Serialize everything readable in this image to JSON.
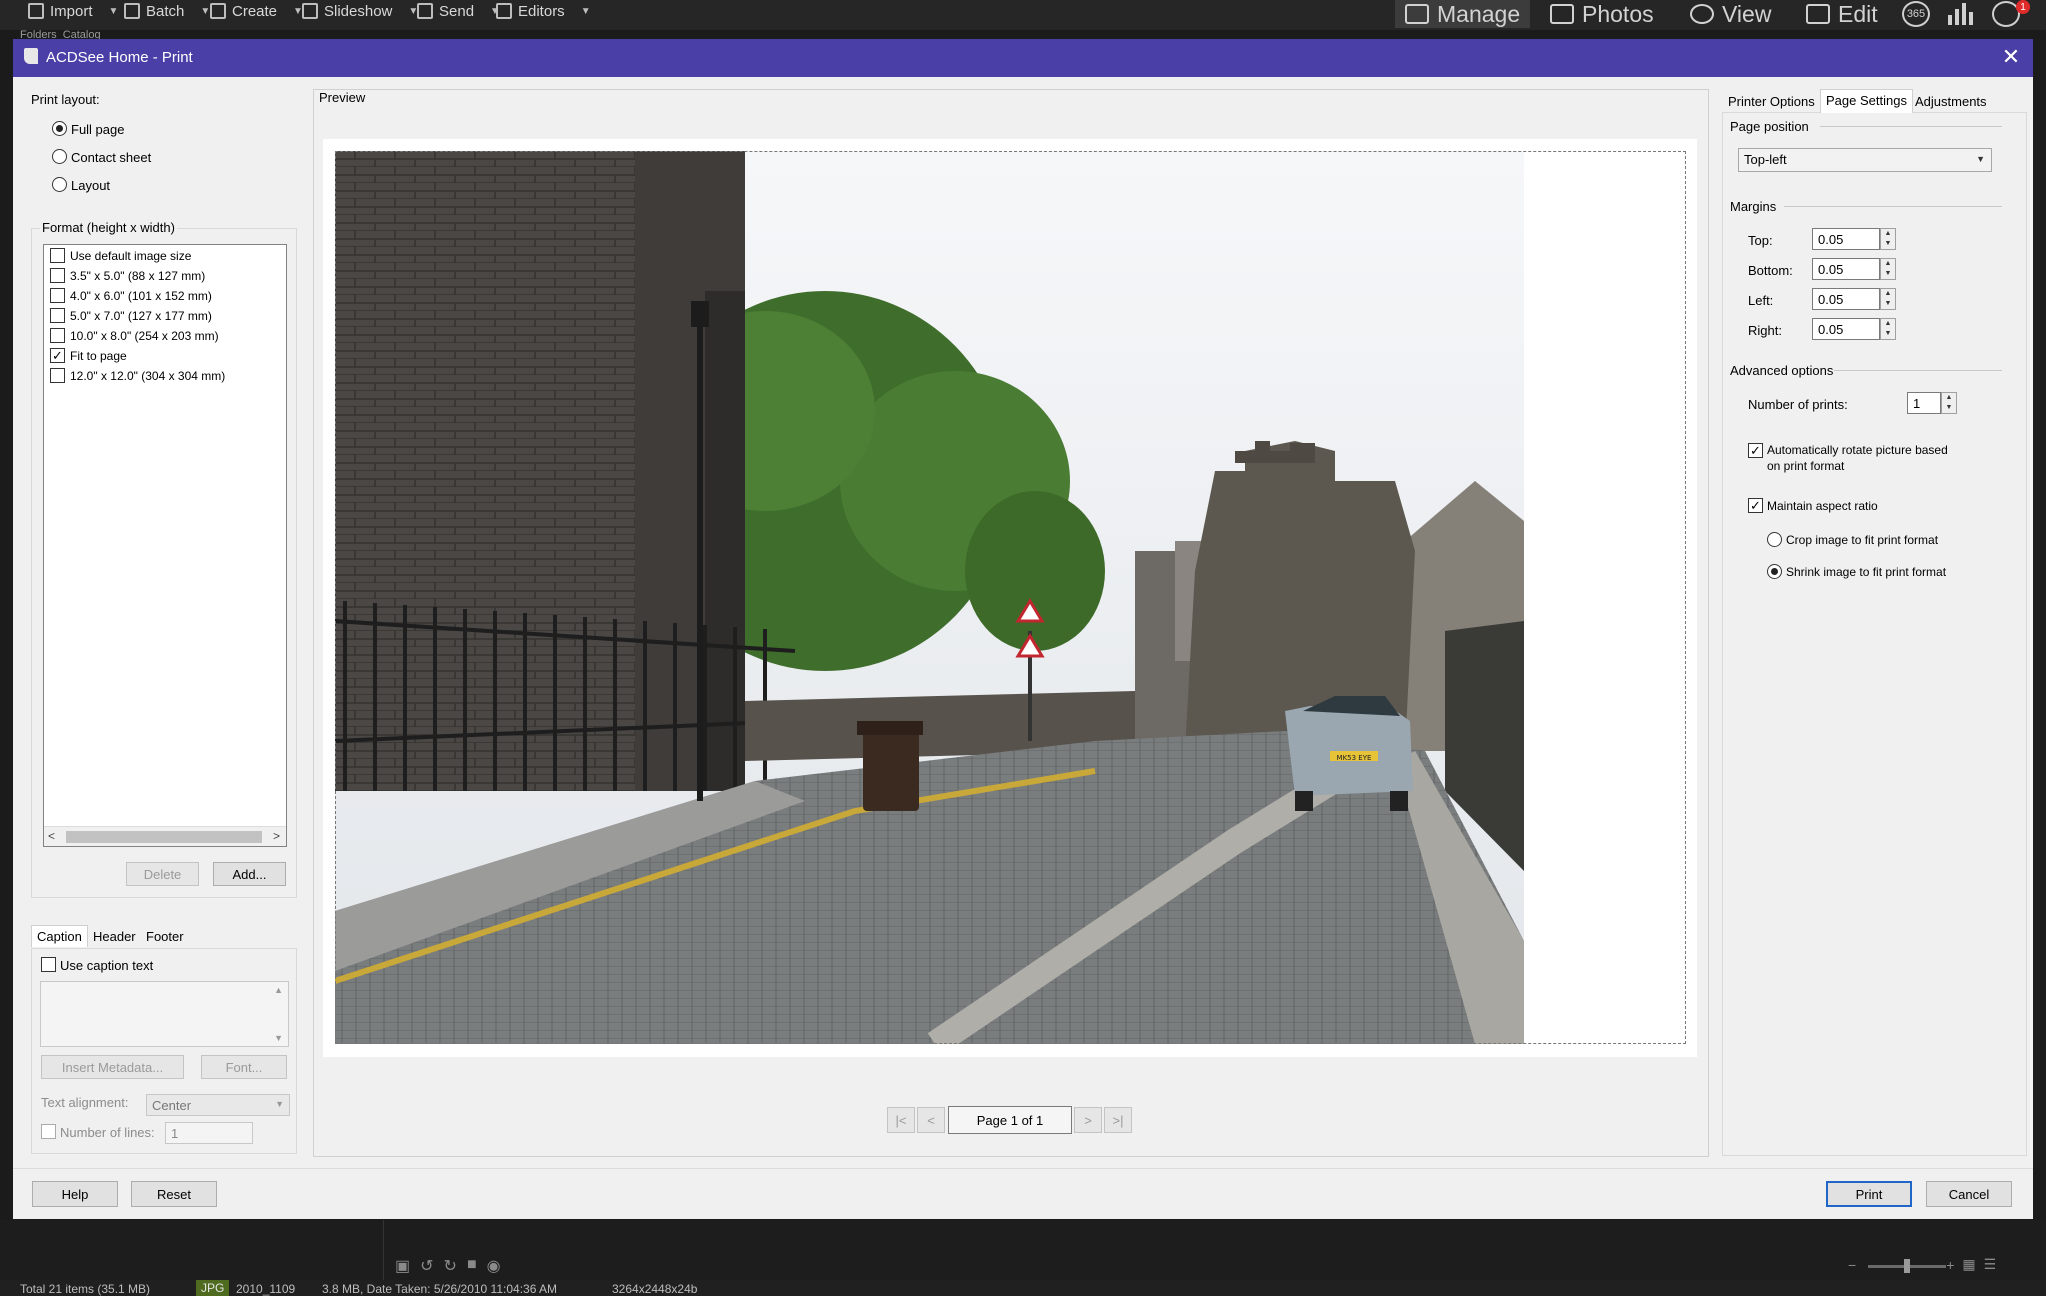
{
  "toolbar": {
    "items": [
      {
        "label": "Import",
        "icon": "import-icon"
      },
      {
        "label": "Batch",
        "icon": "batch-icon"
      },
      {
        "label": "Create",
        "icon": "create-icon"
      },
      {
        "label": "Slideshow",
        "icon": "slideshow-icon"
      },
      {
        "label": "Send",
        "icon": "send-icon"
      },
      {
        "label": "Editors",
        "icon": "editors-icon"
      }
    ],
    "modes": [
      {
        "label": "Manage",
        "icon": "grid-icon",
        "active": true
      },
      {
        "label": "Photos",
        "icon": "photos-icon",
        "active": false
      },
      {
        "label": "View",
        "icon": "eye-icon",
        "active": false
      },
      {
        "label": "Edit",
        "icon": "edit-icon",
        "active": false
      }
    ],
    "badge_365": "365",
    "notification_count": "1",
    "behind_tabs": [
      "Folders",
      "Catalog"
    ]
  },
  "dialog": {
    "title": "ACDSee Home - Print",
    "left": {
      "print_layout_label": "Print layout:",
      "layout_options": [
        "Full page",
        "Contact sheet",
        "Layout"
      ],
      "selected_layout": "Full page",
      "format_label": "Format (height x width)",
      "formats": [
        {
          "label": "Use default image size",
          "checked": false
        },
        {
          "label": "3.5\" x 5.0\" (88 x 127 mm)",
          "checked": false
        },
        {
          "label": "4.0\" x 6.0\" (101 x 152 mm)",
          "checked": false
        },
        {
          "label": "5.0\" x 7.0\" (127 x 177 mm)",
          "checked": false
        },
        {
          "label": "10.0\" x 8.0\" (254 x 203 mm)",
          "checked": false
        },
        {
          "label": "Fit to page",
          "checked": true
        },
        {
          "label": "12.0\" x 12.0\" (304 x 304 mm)",
          "checked": false
        }
      ],
      "delete_label": "Delete",
      "add_label": "Add...",
      "caption_tabs": [
        "Caption",
        "Header",
        "Footer"
      ],
      "use_caption_label": "Use caption text",
      "insert_metadata_label": "Insert Metadata...",
      "font_label": "Font...",
      "text_alignment_label": "Text alignment:",
      "text_alignment_value": "Center",
      "number_of_lines_label": "Number of lines:",
      "number_of_lines_value": "1"
    },
    "preview": {
      "label": "Preview",
      "page_indicator": "Page 1 of 1",
      "nav": [
        "|<",
        "<",
        ">",
        ">|"
      ],
      "plate_text": "MK53 EYE"
    },
    "right": {
      "tabs": [
        "Printer Options",
        "Page Settings",
        "Adjustments"
      ],
      "selected_tab": "Page Settings",
      "page_position_label": "Page position",
      "page_position_value": "Top-left",
      "margins_label": "Margins",
      "margins": [
        {
          "label": "Top:",
          "value": "0.05"
        },
        {
          "label": "Bottom:",
          "value": "0.05"
        },
        {
          "label": "Left:",
          "value": "0.05"
        },
        {
          "label": "Right:",
          "value": "0.05"
        }
      ],
      "advanced_label": "Advanced options",
      "number_of_prints_label": "Number of prints:",
      "number_of_prints_value": "1",
      "auto_rotate_label_1": "Automatically rotate picture based",
      "auto_rotate_label_2": "on print format",
      "maintain_aspect_label": "Maintain aspect ratio",
      "crop_label": "Crop image to fit print format",
      "shrink_label": "Shrink image to fit print format"
    },
    "footer": {
      "help_label": "Help",
      "reset_label": "Reset",
      "print_label": "Print",
      "cancel_label": "Cancel"
    }
  },
  "statusbar": {
    "total": "Total 21 items  (35.1 MB)",
    "format": "JPG",
    "filename": "2010_1109",
    "filesize": "3.8 MB, Date Taken: 5/26/2010 11:04:36 AM",
    "dimensions": "3264x2448x24b"
  },
  "colors": {
    "titlebar": "#4a3fa6",
    "default_button_border": "#2066c8",
    "app_background": "#1b1b1c"
  }
}
